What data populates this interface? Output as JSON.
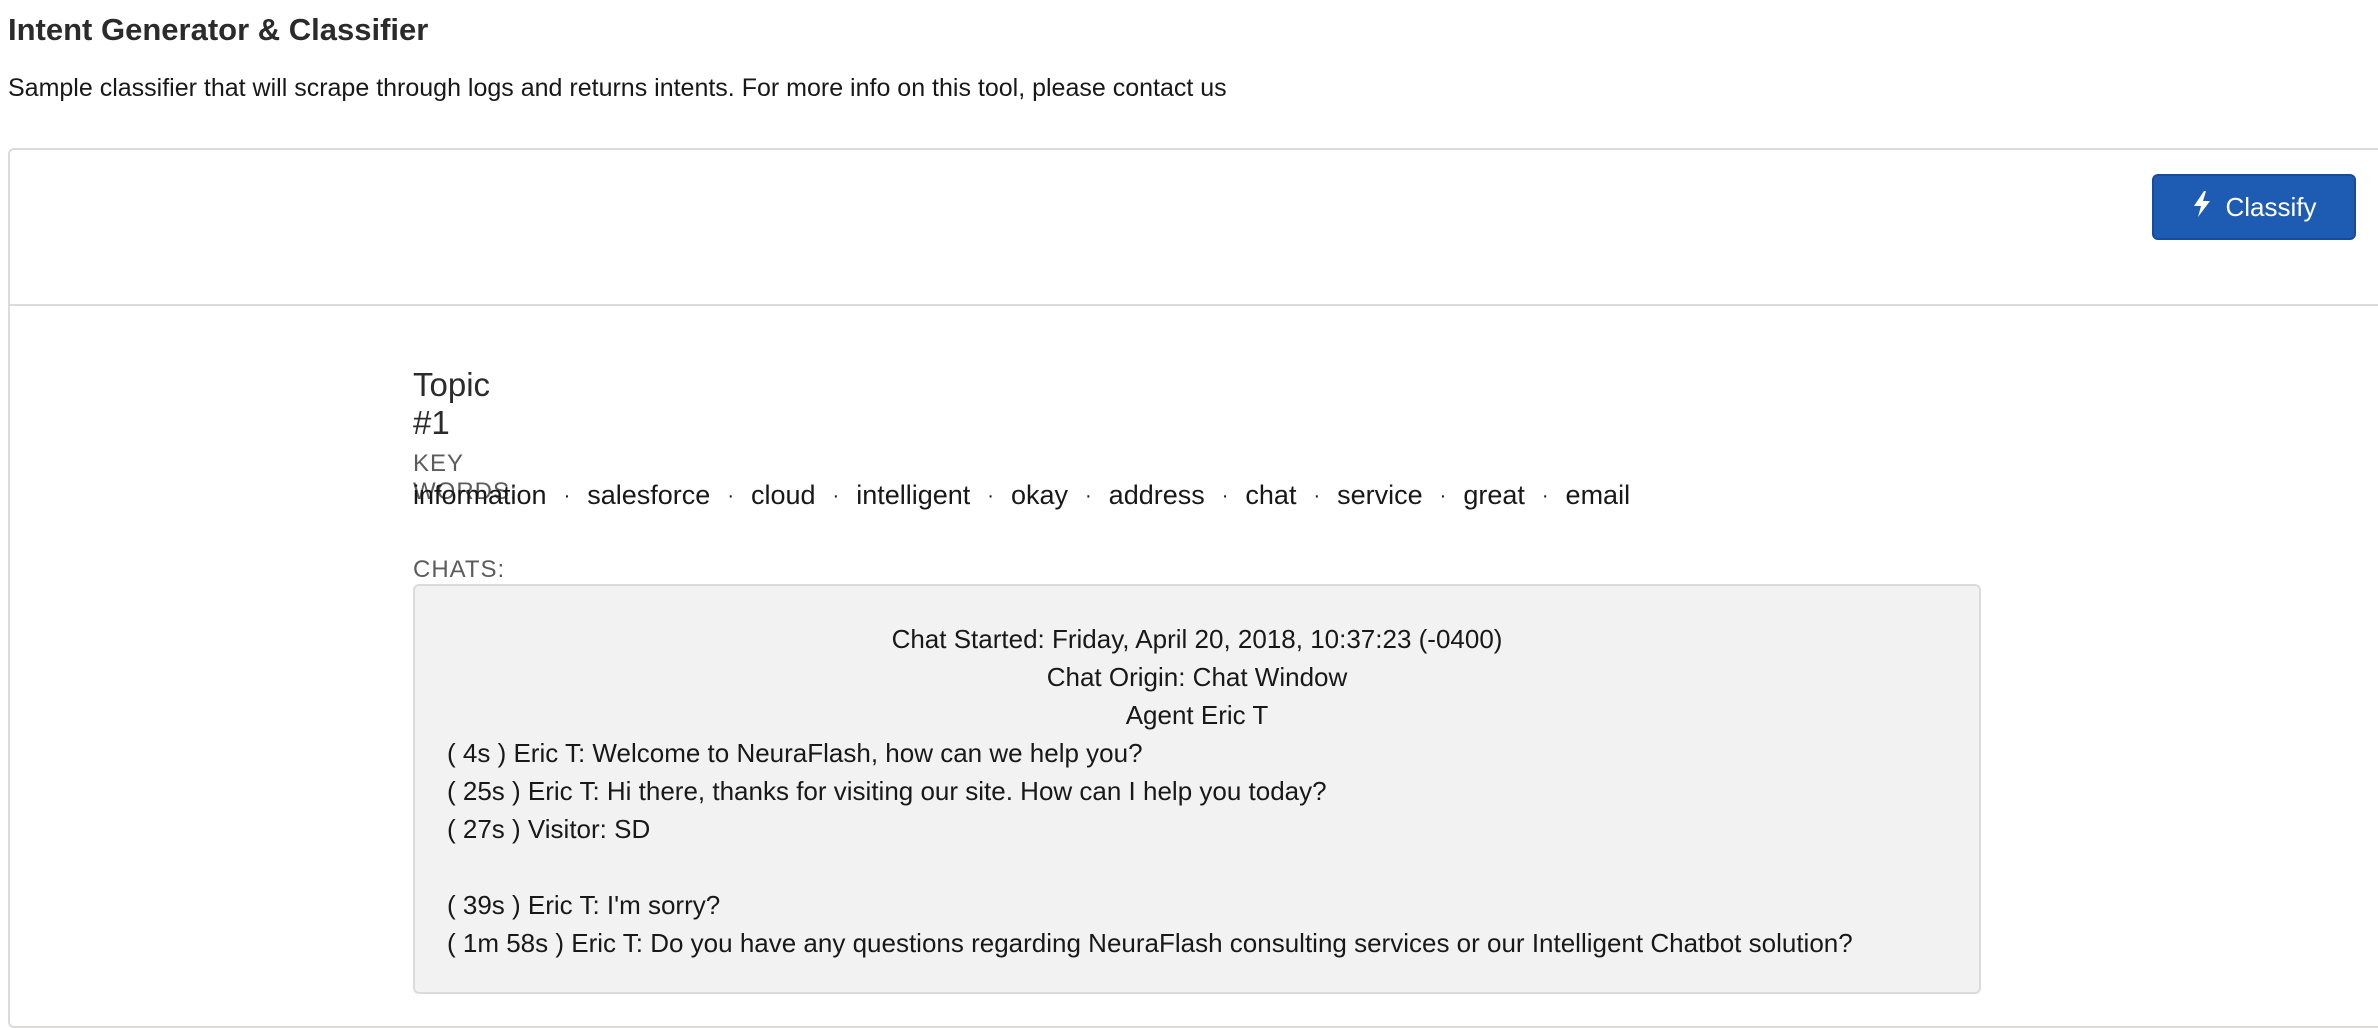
{
  "header": {
    "title": "Intent Generator & Classifier",
    "description": "Sample classifier that will scrape through logs and returns intents. For more info on this tool, please contact us"
  },
  "toolbar": {
    "classify_label": "Classify",
    "classify_icon": "lightning-bolt-icon",
    "accent_color": "#1e5cb3"
  },
  "topic": {
    "title": "Topic #1",
    "keywords_label": "KEY WORDS:",
    "keywords": [
      "information",
      "salesforce",
      "cloud",
      "intelligent",
      "okay",
      "address",
      "chat",
      "service",
      "great",
      "email"
    ],
    "separator": "·",
    "chats_label": "CHATS:",
    "chat": {
      "started": "Chat Started: Friday, April 20, 2018, 10:37:23 (-0400)",
      "origin": "Chat Origin: Chat Window",
      "agent": "Agent Eric T",
      "lines": [
        "( 4s ) Eric T: Welcome to NeuraFlash, how can we help you?",
        "( 25s ) Eric T: Hi there, thanks for visiting our site. How can I help you today?",
        "( 27s ) Visitor: SD",
        "",
        "( 39s ) Eric T: I'm sorry?",
        "( 1m 58s ) Eric T: Do you have any questions regarding NeuraFlash consulting services or our Intelligent Chatbot solution?"
      ]
    }
  }
}
